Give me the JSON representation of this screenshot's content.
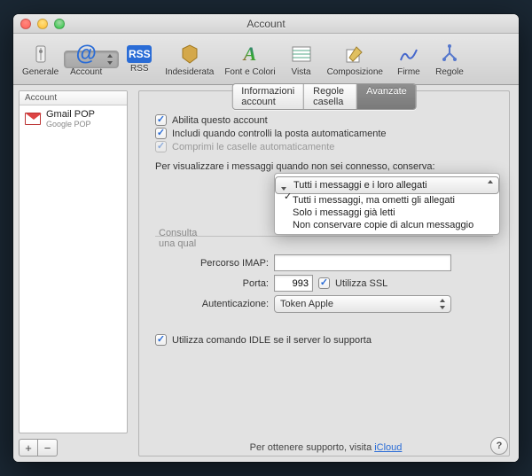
{
  "window": {
    "title": "Account"
  },
  "toolbar": {
    "items": [
      {
        "label": "Generale",
        "icon": "slider-icon"
      },
      {
        "label": "Account",
        "icon": "at-icon",
        "selected": true
      },
      {
        "label": "RSS",
        "icon": "rss-icon"
      },
      {
        "label": "Indesiderata",
        "icon": "junk-icon"
      },
      {
        "label": "Font e Colori",
        "icon": "font-icon"
      },
      {
        "label": "Vista",
        "icon": "view-icon"
      },
      {
        "label": "Composizione",
        "icon": "compose-icon"
      },
      {
        "label": "Firme",
        "icon": "signature-icon"
      },
      {
        "label": "Regole",
        "icon": "rules-icon"
      }
    ]
  },
  "sidebar": {
    "header": "Account",
    "account": {
      "name": "Gmail POP",
      "sub": "Google POP"
    },
    "add": "+",
    "remove": "−"
  },
  "tabs": {
    "items": [
      "Informazioni account",
      "Regole casella",
      "Avanzate"
    ],
    "active": 2
  },
  "checks": {
    "enable": "Abilita questo account",
    "include": "Includi quando controlli la posta automaticamente",
    "compress": "Comprimi le caselle automaticamente"
  },
  "offline": {
    "label": "Per visualizzare i messaggi quando non sei connesso, conserva:",
    "options": [
      "Tutti i messaggi e i loro allegati",
      "Tutti i messaggi, ma ometti gli allegati",
      "Solo i messaggi già letti",
      "Non conservare copie di alcun messaggio"
    ],
    "selected": 0
  },
  "consulta": {
    "l1": "Consulta",
    "l2": "una qual"
  },
  "form": {
    "imap_path_label": "Percorso IMAP:",
    "imap_path": "",
    "port_label": "Porta:",
    "port": "993",
    "ssl": "Utilizza SSL",
    "auth_label": "Autenticazione:",
    "auth_value": "Token Apple"
  },
  "idle": "Utilizza comando IDLE se il server lo supporta",
  "footer": {
    "text": "Per ottenere supporto, visita ",
    "link": "iCloud"
  },
  "help": "?"
}
